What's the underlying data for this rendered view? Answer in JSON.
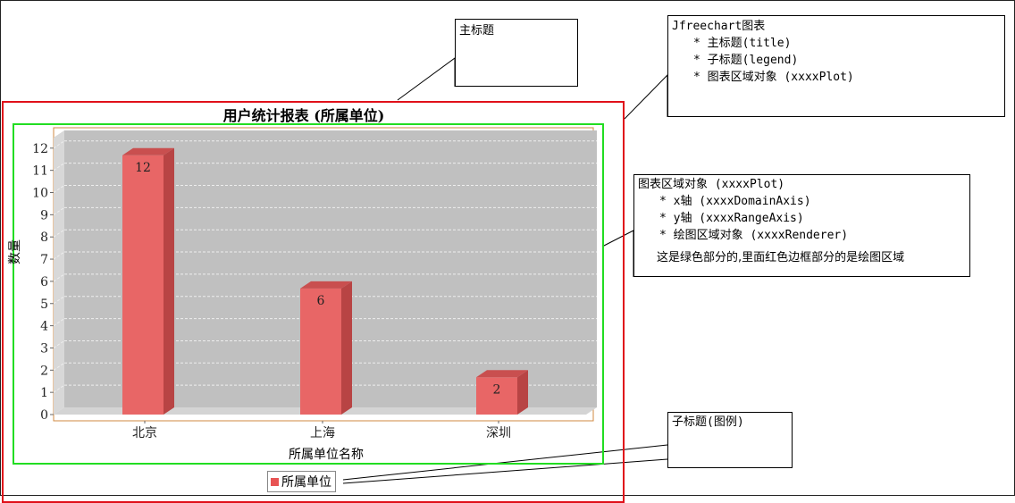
{
  "main_title_callout": "主标题",
  "jfree_callout": {
    "title": "Jfreechart图表",
    "items": [
      "* 主标题(title)",
      "* 子标题(legend)",
      "* 图表区域对象 (xxxxPlot)"
    ]
  },
  "plot_callout": {
    "title": "图表区域对象 (xxxxPlot)",
    "items": [
      "* x轴 (xxxxDomainAxis)",
      "* y轴 (xxxxRangeAxis)",
      "* 绘图区域对象 (xxxxRenderer)"
    ],
    "note": "这是绿色部分的,里面红色边框部分的是绘图区域"
  },
  "legend_callout": "子标题(图例)",
  "chart_data": {
    "type": "bar",
    "title": "用户统计报表 (所属单位)",
    "categories": [
      "北京",
      "上海",
      "深圳"
    ],
    "values": [
      12,
      6,
      2
    ],
    "xlabel": "所属单位名称",
    "ylabel": "数量",
    "ylim": [
      0,
      12.8
    ],
    "yticks": [
      0,
      1,
      2,
      3,
      4,
      5,
      6,
      7,
      8,
      9,
      10,
      11,
      12
    ],
    "legend": "所属单位",
    "colors": {
      "bar": "#e86666",
      "bar_side": "#b84444",
      "bar_top": "#c94f4f",
      "plot_bg": "#c0c0c0"
    }
  }
}
